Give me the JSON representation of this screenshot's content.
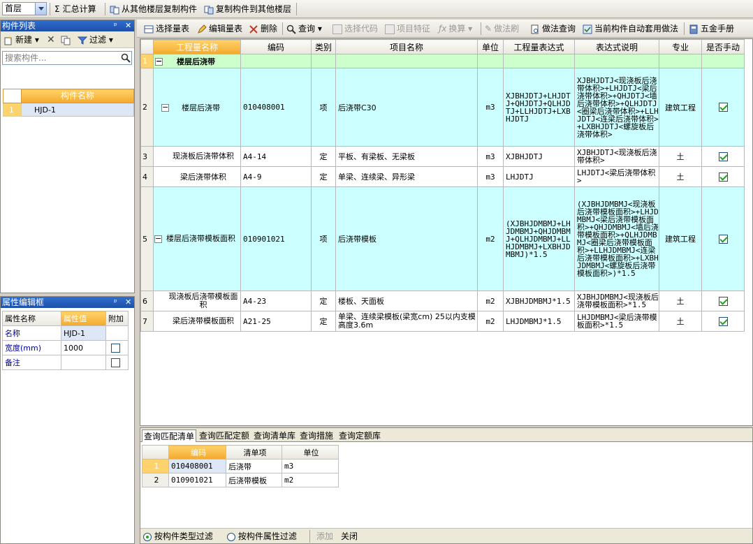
{
  "topbar": {
    "floor": "首层",
    "sum": "汇总计算",
    "copy_from": "从其他楼层复制构件",
    "copy_to": "复制构件到其他楼层"
  },
  "comp_panel": {
    "title": "构件列表",
    "new": "新建",
    "filter": "过滤",
    "search_placeholder": "搜索构件...",
    "col_name": "构件名称",
    "rows": [
      {
        "n": "1",
        "name": "HJD-1"
      }
    ]
  },
  "prop_panel": {
    "title": "属性编辑框",
    "headers": [
      "属性名称",
      "属性值",
      "附加"
    ],
    "rows": [
      {
        "name": "名称",
        "value": "HJD-1"
      },
      {
        "name": "宽度(mm)",
        "value": "1000"
      },
      {
        "name": "备注",
        "value": ""
      }
    ]
  },
  "main_toolbar": {
    "select": "选择量表",
    "edit": "编辑量表",
    "delete": "删除",
    "query": "查询",
    "select_code": "选择代码",
    "features": "项目特征",
    "convert": "换算",
    "method_brush": "做法刷",
    "method_query": "做法查询",
    "auto_apply": "当前构件自动套用做法",
    "hardware": "五金手册"
  },
  "grid": {
    "headers": [
      "工程量名称",
      "编码",
      "类别",
      "项目名称",
      "单位",
      "工程量表达式",
      "表达式说明",
      "专业",
      "是否手动"
    ],
    "rows": [
      {
        "n": "1",
        "name": "楼层后浇带",
        "code": "",
        "type": "",
        "item": "",
        "unit": "",
        "expr": "",
        "desc": "",
        "major": "",
        "manual": ""
      },
      {
        "n": "2",
        "name": "楼层后浇带",
        "code": "010408001",
        "type": "项",
        "item": "后浇带C30",
        "unit": "m3",
        "expr": "XJBHJDTJ+LHJDTJ+QHJDTJ+QLHJDTJ+LLHJDTJ+LXBHJDTJ",
        "desc": "XJBHJDTJ<现浇板后浇带体积>+LHJDTJ<梁后浇带体积>+QHJDTJ<墙后浇带体积>+QLHJDTJ<圈梁后浇带体积>+LLHJDTJ<连梁后浇带体积>+LXBHJDTJ<螺旋板后浇带体积>",
        "major": "建筑工程",
        "manual": "true"
      },
      {
        "n": "3",
        "name": "现浇板后浇带体积",
        "code": "A4-14",
        "type": "定",
        "item": "平板、有梁板、无梁板",
        "unit": "m3",
        "expr": "XJBHJDTJ",
        "desc": "XJBHJDTJ<现浇板后浇带体积>",
        "major": "土",
        "manual": "true"
      },
      {
        "n": "4",
        "name": "梁后浇带体积",
        "code": "A4-9",
        "type": "定",
        "item": "单梁、连续梁、异形梁",
        "unit": "m3",
        "expr": "LHJDTJ",
        "desc": "LHJDTJ<梁后浇带体积>",
        "major": "土",
        "manual": "true"
      },
      {
        "n": "5",
        "name": "楼层后浇带模板面积",
        "code": "010901021",
        "type": "项",
        "item": "后浇带模板",
        "unit": "m2",
        "expr": "(XJBHJDMBMJ+LHJDMBMJ+QHJDMBMJ+QLHJDMBMJ+LLHJDMBMJ+LXBHJDMBMJ)*1.5",
        "desc": "(XJBHJDMBMJ<现浇板后浇带模板面积>+LHJDMBMJ<梁后浇带模板面积>+QHJDMBMJ<墙后浇带模板面积>+QLHJDMBMJ<圈梁后浇带模板面积>+LLHJDMBMJ<连梁后浇带模板面积>+LXBHJDMBMJ<螺旋板后浇带模板面积>)*1.5",
        "major": "建筑工程",
        "manual": "true"
      },
      {
        "n": "6",
        "name": "现浇板后浇带模板面积",
        "code": "A4-23",
        "type": "定",
        "item": "楼板、天面板",
        "unit": "m2",
        "expr": "XJBHJDMBMJ*1.5",
        "desc": "XJBHJDMBMJ<现浇板后浇带模板面积>*1.5",
        "major": "土",
        "manual": "true"
      },
      {
        "n": "7",
        "name": "梁后浇带模板面积",
        "code": "A21-25",
        "type": "定",
        "item": "单梁、连续梁模板(梁宽cm) 25以内支模高度3.6m",
        "unit": "m2",
        "expr": "LHJDMBMJ*1.5",
        "desc": "LHJDMBMJ<梁后浇带模板面积>*1.5",
        "major": "土",
        "manual": "true"
      }
    ]
  },
  "bottom": {
    "tabs": [
      "查询匹配清单",
      "查询匹配定额",
      "查询清单库",
      "查询措施",
      "查询定额库"
    ],
    "headers": [
      "编码",
      "清单项",
      "单位"
    ],
    "rows": [
      {
        "n": "1",
        "code": "010408001",
        "name": "后浇带",
        "unit": "m3"
      },
      {
        "n": "2",
        "code": "010901021",
        "name": "后浇带模板",
        "unit": "m2"
      }
    ],
    "radio1": "按构件类型过滤",
    "radio2": "按构件属性过滤",
    "add": "添加",
    "close": "关闭"
  }
}
